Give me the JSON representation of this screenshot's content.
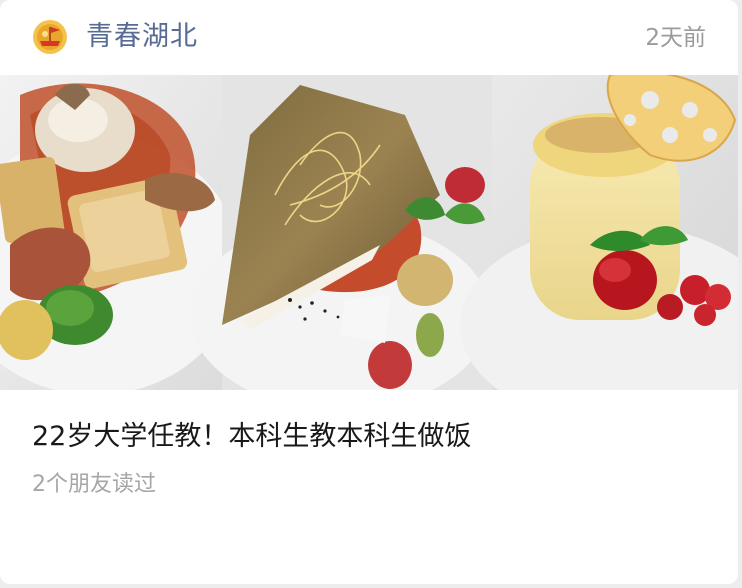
{
  "header": {
    "account_name": "青春湖北",
    "time_ago": "2天前",
    "avatar_icon": "youth-league-emblem-icon"
  },
  "article": {
    "title": "22岁大学任教！本科生教本科生做饭",
    "friends_read": "2个朋友读过",
    "cover_description_icon": "plated-dishes-photo"
  },
  "colors": {
    "account_name": "#576b95",
    "meta_text": "#9b9b9b",
    "title_text": "#191919",
    "card_bg": "#ffffff",
    "page_bg": "#ededed"
  }
}
